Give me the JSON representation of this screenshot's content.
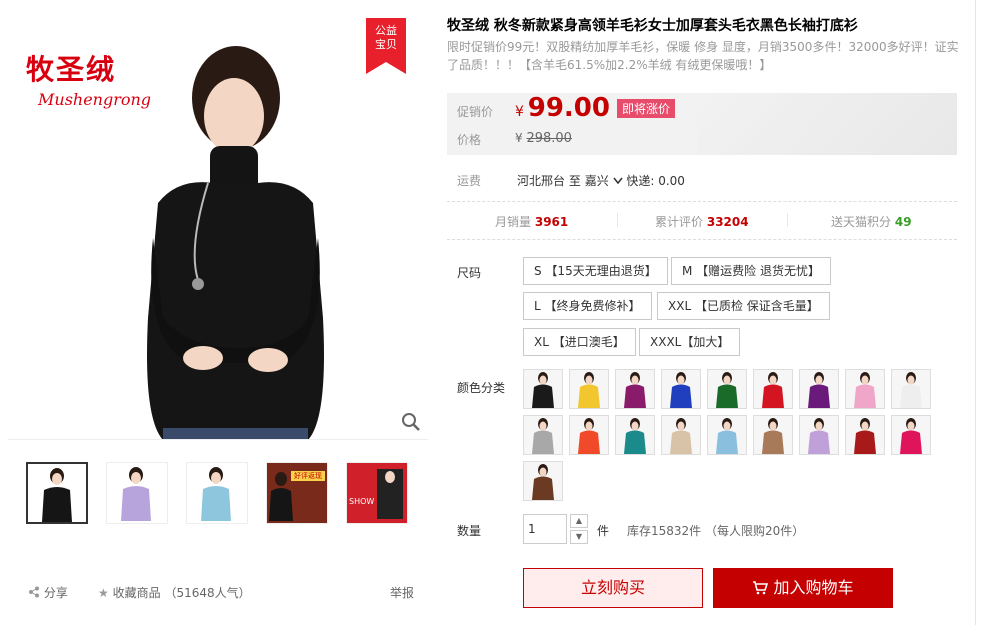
{
  "gallery": {
    "brand_cn": "牧圣绒",
    "brand_en": "Mushengrong",
    "badge_line1": "公益",
    "badge_line2": "宝贝",
    "thumb_banner_text": "好评返现",
    "thumb_show_text": "SHOW"
  },
  "footer": {
    "share": "分享",
    "favorite": "收藏商品",
    "popularity": "（51648人气）",
    "report": "举报"
  },
  "product": {
    "title": "牧圣绒 秋冬新款紧身高领羊毛衫女士加厚套头毛衣黑色长袖打底衫",
    "subtitle": "限时促销价99元！双股精纺加厚羊毛衫，保暖 修身 显度，月销3500多件！32000多好评！证实了品质！！！【含羊毛61.5%加2.2%羊绒 有绒更保暖哦！】"
  },
  "price": {
    "promo_label": "促销价",
    "currency": "¥",
    "promo_value": "99.00",
    "tag": "即将涨价",
    "orig_label": "价格",
    "orig_value": "298.00"
  },
  "shipping": {
    "label": "运费",
    "from": "河北邢台",
    "to_word": "至",
    "to": "嘉兴",
    "fee": "快递: 0.00"
  },
  "stats": {
    "monthly_label": "月销量",
    "monthly_value": "3961",
    "reviews_label": "累计评价",
    "reviews_value": "33204",
    "points_label": "送天猫积分",
    "points_value": "49"
  },
  "sizes": {
    "label": "尺码",
    "options": [
      "S 【15天无理由退货】",
      "M 【赠运费险 退货无忧】",
      "L 【终身免费修补】",
      "XXL 【已质检 保证含毛量】",
      "XL 【进口澳毛】",
      "XXXL【加大】"
    ]
  },
  "colors": {
    "label": "颜色分类",
    "swatches": [
      "#1a1a1a",
      "#f2c62e",
      "#8a1a6a",
      "#1f3fbf",
      "#1a6a2a",
      "#d41420",
      "#6a1a7a",
      "#f0a6c8",
      "#eeeeee",
      "#a8a8a8",
      "#f04a2a",
      "#1a8a8a",
      "#d8c2a8",
      "#8ac0de",
      "#a87a5a",
      "#c0a0d8",
      "#a81a1a",
      "#e0145a",
      "#6a3a22"
    ]
  },
  "quantity": {
    "label": "数量",
    "value": "1",
    "unit": "件",
    "stock": "库存15832件",
    "limit": "（每人限购20件）"
  },
  "actions": {
    "buy_now": "立刻购买",
    "add_to_cart": "加入购物车"
  }
}
